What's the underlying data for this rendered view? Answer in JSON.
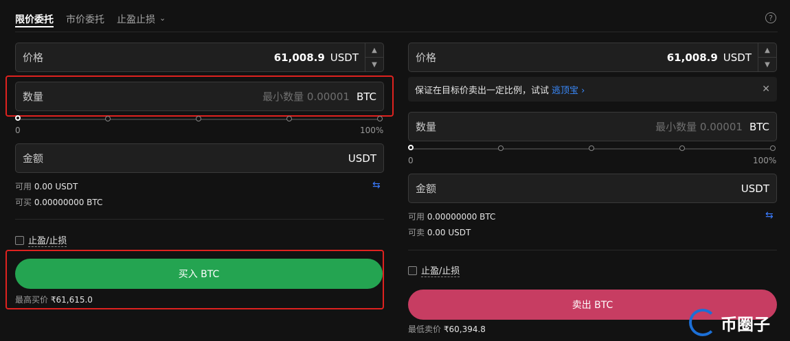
{
  "tabs": {
    "limit": "限价委托",
    "market": "市价委托",
    "tpsl": "止盈止损"
  },
  "help": "?",
  "buy": {
    "price_label": "价格",
    "price_value": "61,008.9",
    "price_unit": "USDT",
    "qty_label": "数量",
    "qty_placeholder": "最小数量 0.00001",
    "qty_unit": "BTC",
    "slider_min": "0",
    "slider_max": "100%",
    "amount_label": "金额",
    "amount_unit": "USDT",
    "avail_label": "可用",
    "avail_value": "0.00 USDT",
    "canbuy_label": "可买",
    "canbuy_value": "0.00000000 BTC",
    "tpsl_label": "止盈/止损",
    "button": "买入 BTC",
    "best_label": "最高买价",
    "best_value": "₹61,615.0"
  },
  "sell": {
    "price_label": "价格",
    "price_value": "61,008.9",
    "price_unit": "USDT",
    "notice_text": "保证在目标价卖出一定比例，试试",
    "notice_link": "逃顶宝",
    "qty_label": "数量",
    "qty_placeholder": "最小数量 0.00001",
    "qty_unit": "BTC",
    "slider_min": "0",
    "slider_max": "100%",
    "amount_label": "金额",
    "amount_unit": "USDT",
    "avail_label": "可用",
    "avail_value": "0.00000000 BTC",
    "cansell_label": "可卖",
    "cansell_value": "0.00 USDT",
    "tpsl_label": "止盈/止损",
    "button": "卖出 BTC",
    "best_label": "最低卖价",
    "best_value": "₹60,394.8"
  },
  "watermark": "币圈子",
  "colors": {
    "buy": "#24a451",
    "sell": "#c73d62",
    "highlight": "#e0221f",
    "link": "#3a8bff"
  }
}
